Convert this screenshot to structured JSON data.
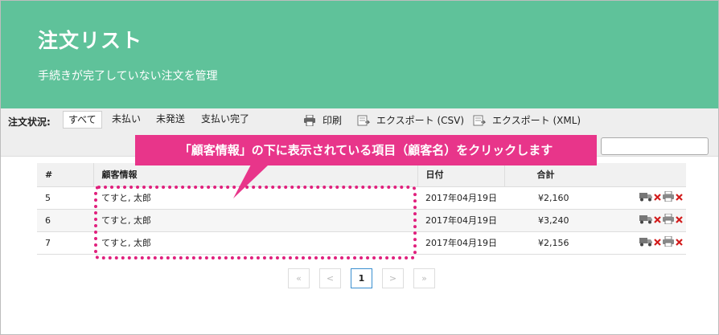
{
  "header": {
    "title": "注文リスト",
    "subtitle": "手続きが完了していない注文を管理"
  },
  "toolbar": {
    "status_label": "注文状況:",
    "filters": [
      "すべて",
      "未払い",
      "未発送",
      "支払い完了"
    ],
    "active_filter": "すべて",
    "actions": {
      "print": "印刷",
      "export_csv": "エクスポート (CSV)",
      "export_xml": "エクスポート (XML)"
    },
    "search": {
      "value": ""
    }
  },
  "callout": {
    "text": "「顧客情報」の下に表示されている項目（顧客名）をクリックします",
    "color": "#e8358a"
  },
  "table": {
    "columns": [
      "#",
      "顧客情報",
      "日付",
      "合計"
    ],
    "rows": [
      {
        "id": "5",
        "customer": "てすと, 太郎",
        "date": "2017年04月19日",
        "total": "¥2,160"
      },
      {
        "id": "6",
        "customer": "てすと, 太郎",
        "date": "2017年04月19日",
        "total": "¥3,240"
      },
      {
        "id": "7",
        "customer": "てすと, 太郎",
        "date": "2017年04月19日",
        "total": "¥2,156"
      }
    ],
    "row_icons": [
      "truck-icon",
      "delete-x-icon",
      "printer-icon",
      "delete-x-icon"
    ]
  },
  "pagination": {
    "first": "«",
    "prev": "<",
    "current": "1",
    "next": ">",
    "last": "»"
  },
  "colors": {
    "header_bg": "#5fc29a",
    "highlight": "#e0207d",
    "pager_active_border": "#3a8fd0"
  }
}
